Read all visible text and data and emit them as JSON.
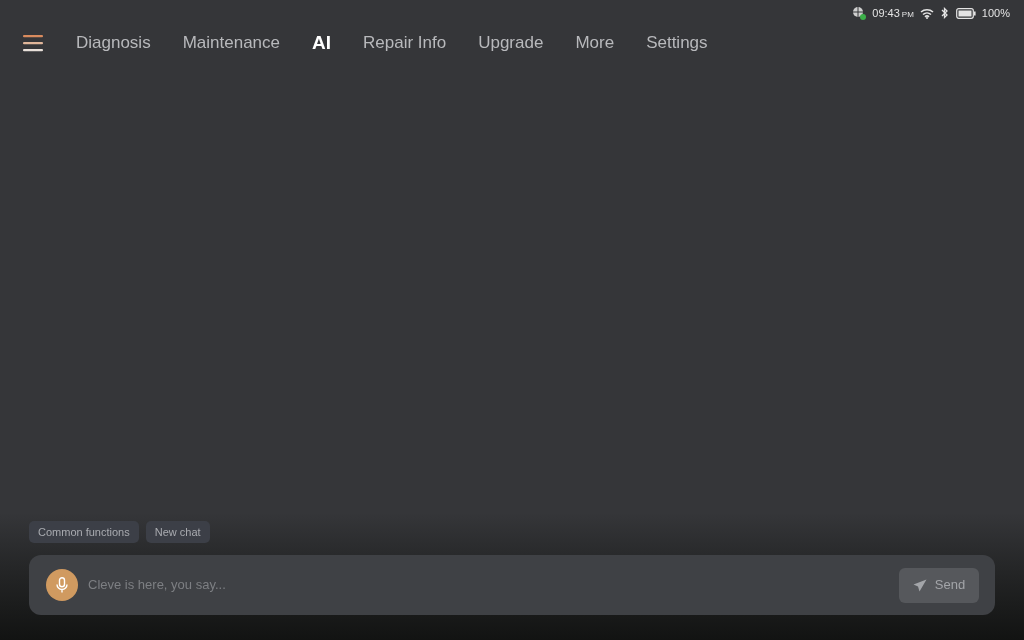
{
  "status_bar": {
    "time": "09:43",
    "meridiem": "PM",
    "battery": "100%"
  },
  "tabs": [
    {
      "label": "Diagnosis",
      "selected": false
    },
    {
      "label": "Maintenance",
      "selected": false
    },
    {
      "label": "AI",
      "selected": true
    },
    {
      "label": "Repair Info",
      "selected": false
    },
    {
      "label": "Upgrade",
      "selected": false
    },
    {
      "label": "More",
      "selected": false
    },
    {
      "label": "Settings",
      "selected": false
    }
  ],
  "quick_actions": [
    "Common functions",
    "New chat"
  ],
  "composer": {
    "placeholder": "Cleve is here, you say...",
    "send_button": {
      "label": "Send",
      "disabled": true
    }
  }
}
